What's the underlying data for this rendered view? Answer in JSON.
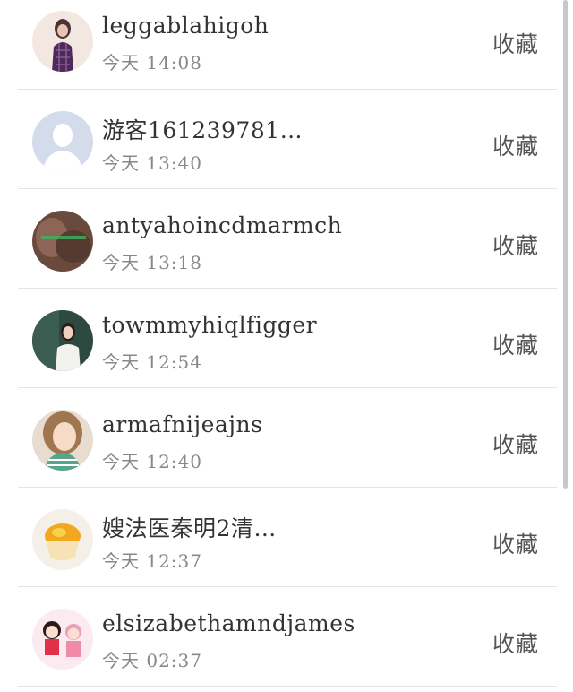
{
  "list": {
    "items": [
      {
        "name": "leggablahigoh",
        "time": "今天 14:08",
        "action": "收藏",
        "avatar": "girl-photo-icon"
      },
      {
        "name": "游客161239781…",
        "time": "今天 13:40",
        "action": "收藏",
        "avatar": "default-user-icon"
      },
      {
        "name": "antyahoincdmarmch",
        "time": "今天 13:18",
        "action": "收藏",
        "avatar": "brown-photo-icon"
      },
      {
        "name": "towmmyhiqlfigger",
        "time": "今天 12:54",
        "action": "收藏",
        "avatar": "woman-portrait-icon"
      },
      {
        "name": "armafnijeajns",
        "time": "今天 12:40",
        "action": "收藏",
        "avatar": "smiling-girl-icon"
      },
      {
        "name": "嫂法医秦明2清…",
        "time": "今天 12:37",
        "action": "收藏",
        "avatar": "dessert-photo-icon"
      },
      {
        "name": "elsizabethamndjames",
        "time": "今天 02:37",
        "action": "收藏",
        "avatar": "cartoon-couple-icon"
      }
    ]
  },
  "colors": {
    "name_text": "#333333",
    "time_text": "#888888",
    "divider": "#e4e4e4",
    "default_avatar_bg": "#d4dcec"
  }
}
